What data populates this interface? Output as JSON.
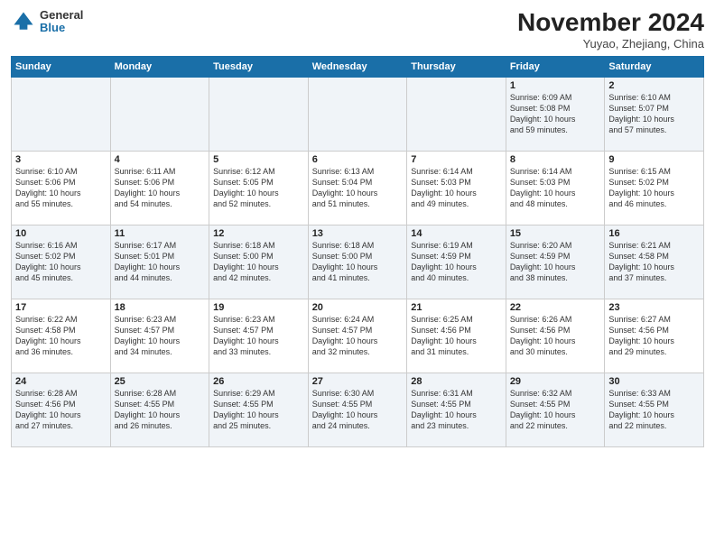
{
  "logo": {
    "general": "General",
    "blue": "Blue"
  },
  "header": {
    "month": "November 2024",
    "location": "Yuyao, Zhejiang, China"
  },
  "weekdays": [
    "Sunday",
    "Monday",
    "Tuesday",
    "Wednesday",
    "Thursday",
    "Friday",
    "Saturday"
  ],
  "weeks": [
    [
      {
        "day": "",
        "info": ""
      },
      {
        "day": "",
        "info": ""
      },
      {
        "day": "",
        "info": ""
      },
      {
        "day": "",
        "info": ""
      },
      {
        "day": "",
        "info": ""
      },
      {
        "day": "1",
        "info": "Sunrise: 6:09 AM\nSunset: 5:08 PM\nDaylight: 10 hours\nand 59 minutes."
      },
      {
        "day": "2",
        "info": "Sunrise: 6:10 AM\nSunset: 5:07 PM\nDaylight: 10 hours\nand 57 minutes."
      }
    ],
    [
      {
        "day": "3",
        "info": "Sunrise: 6:10 AM\nSunset: 5:06 PM\nDaylight: 10 hours\nand 55 minutes."
      },
      {
        "day": "4",
        "info": "Sunrise: 6:11 AM\nSunset: 5:06 PM\nDaylight: 10 hours\nand 54 minutes."
      },
      {
        "day": "5",
        "info": "Sunrise: 6:12 AM\nSunset: 5:05 PM\nDaylight: 10 hours\nand 52 minutes."
      },
      {
        "day": "6",
        "info": "Sunrise: 6:13 AM\nSunset: 5:04 PM\nDaylight: 10 hours\nand 51 minutes."
      },
      {
        "day": "7",
        "info": "Sunrise: 6:14 AM\nSunset: 5:03 PM\nDaylight: 10 hours\nand 49 minutes."
      },
      {
        "day": "8",
        "info": "Sunrise: 6:14 AM\nSunset: 5:03 PM\nDaylight: 10 hours\nand 48 minutes."
      },
      {
        "day": "9",
        "info": "Sunrise: 6:15 AM\nSunset: 5:02 PM\nDaylight: 10 hours\nand 46 minutes."
      }
    ],
    [
      {
        "day": "10",
        "info": "Sunrise: 6:16 AM\nSunset: 5:02 PM\nDaylight: 10 hours\nand 45 minutes."
      },
      {
        "day": "11",
        "info": "Sunrise: 6:17 AM\nSunset: 5:01 PM\nDaylight: 10 hours\nand 44 minutes."
      },
      {
        "day": "12",
        "info": "Sunrise: 6:18 AM\nSunset: 5:00 PM\nDaylight: 10 hours\nand 42 minutes."
      },
      {
        "day": "13",
        "info": "Sunrise: 6:18 AM\nSunset: 5:00 PM\nDaylight: 10 hours\nand 41 minutes."
      },
      {
        "day": "14",
        "info": "Sunrise: 6:19 AM\nSunset: 4:59 PM\nDaylight: 10 hours\nand 40 minutes."
      },
      {
        "day": "15",
        "info": "Sunrise: 6:20 AM\nSunset: 4:59 PM\nDaylight: 10 hours\nand 38 minutes."
      },
      {
        "day": "16",
        "info": "Sunrise: 6:21 AM\nSunset: 4:58 PM\nDaylight: 10 hours\nand 37 minutes."
      }
    ],
    [
      {
        "day": "17",
        "info": "Sunrise: 6:22 AM\nSunset: 4:58 PM\nDaylight: 10 hours\nand 36 minutes."
      },
      {
        "day": "18",
        "info": "Sunrise: 6:23 AM\nSunset: 4:57 PM\nDaylight: 10 hours\nand 34 minutes."
      },
      {
        "day": "19",
        "info": "Sunrise: 6:23 AM\nSunset: 4:57 PM\nDaylight: 10 hours\nand 33 minutes."
      },
      {
        "day": "20",
        "info": "Sunrise: 6:24 AM\nSunset: 4:57 PM\nDaylight: 10 hours\nand 32 minutes."
      },
      {
        "day": "21",
        "info": "Sunrise: 6:25 AM\nSunset: 4:56 PM\nDaylight: 10 hours\nand 31 minutes."
      },
      {
        "day": "22",
        "info": "Sunrise: 6:26 AM\nSunset: 4:56 PM\nDaylight: 10 hours\nand 30 minutes."
      },
      {
        "day": "23",
        "info": "Sunrise: 6:27 AM\nSunset: 4:56 PM\nDaylight: 10 hours\nand 29 minutes."
      }
    ],
    [
      {
        "day": "24",
        "info": "Sunrise: 6:28 AM\nSunset: 4:56 PM\nDaylight: 10 hours\nand 27 minutes."
      },
      {
        "day": "25",
        "info": "Sunrise: 6:28 AM\nSunset: 4:55 PM\nDaylight: 10 hours\nand 26 minutes."
      },
      {
        "day": "26",
        "info": "Sunrise: 6:29 AM\nSunset: 4:55 PM\nDaylight: 10 hours\nand 25 minutes."
      },
      {
        "day": "27",
        "info": "Sunrise: 6:30 AM\nSunset: 4:55 PM\nDaylight: 10 hours\nand 24 minutes."
      },
      {
        "day": "28",
        "info": "Sunrise: 6:31 AM\nSunset: 4:55 PM\nDaylight: 10 hours\nand 23 minutes."
      },
      {
        "day": "29",
        "info": "Sunrise: 6:32 AM\nSunset: 4:55 PM\nDaylight: 10 hours\nand 22 minutes."
      },
      {
        "day": "30",
        "info": "Sunrise: 6:33 AM\nSunset: 4:55 PM\nDaylight: 10 hours\nand 22 minutes."
      }
    ]
  ]
}
